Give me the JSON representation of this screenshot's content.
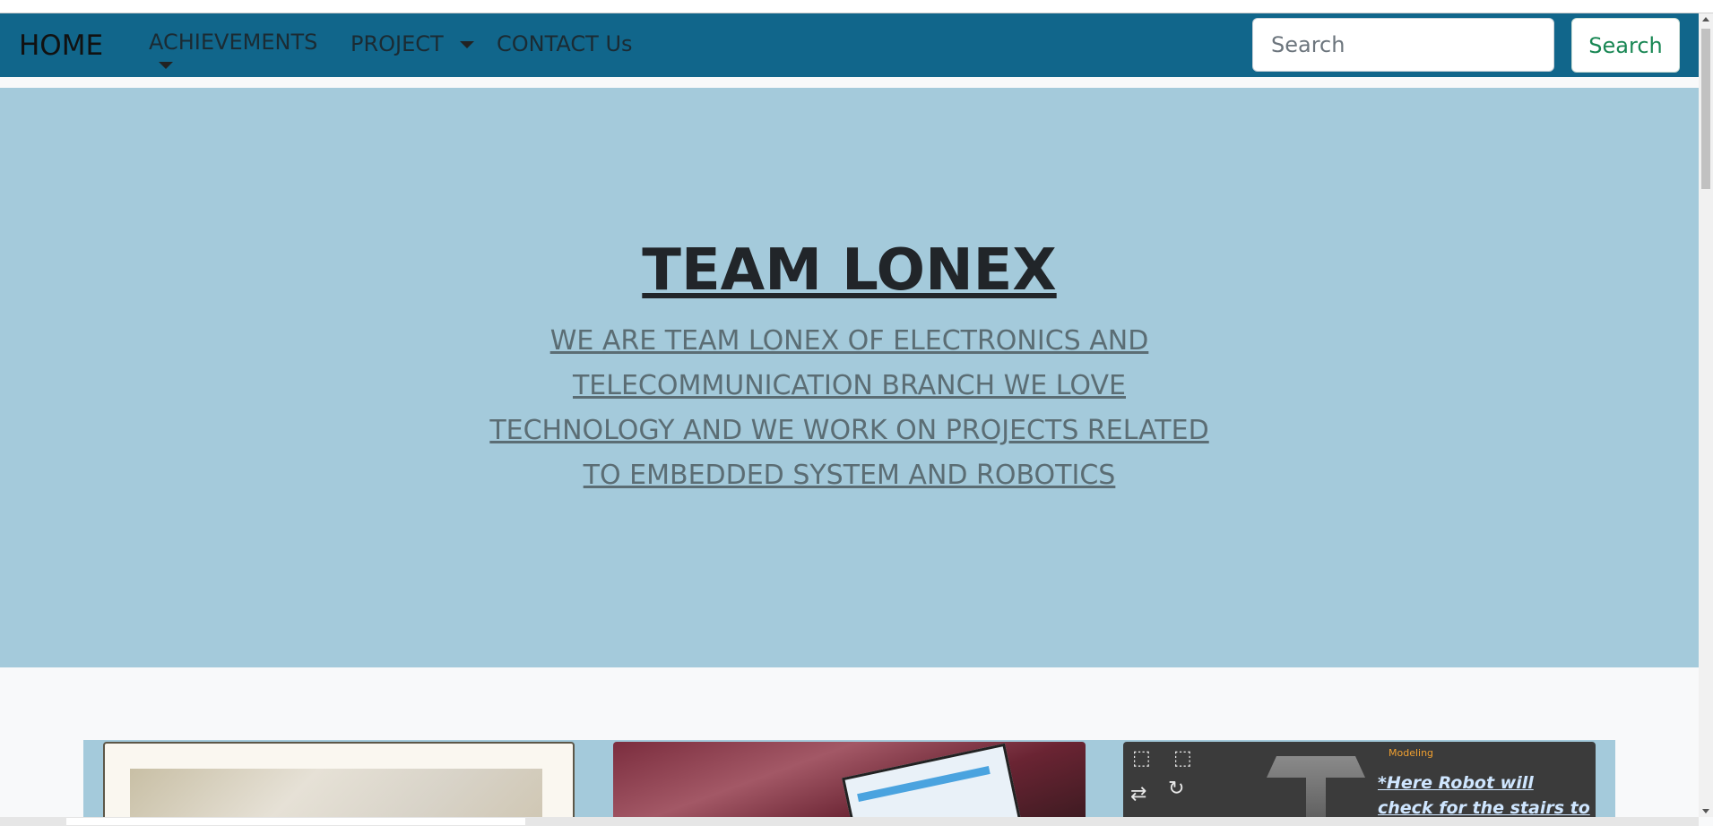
{
  "nav": {
    "brand": "HOME",
    "achievements": "ACHIEVEMENTS",
    "project": "PROJECT",
    "contact": "CONTACT Us",
    "search_placeholder": "Search",
    "search_button": "Search"
  },
  "hero": {
    "title": "TEAM LONEX",
    "subtitle": "WE ARE TEAM LONEX OF ELECTRONICS AND TELECOMMUNICATION BRANCH WE LOVE TECHNOLOGY AND WE WORK ON PROJECTS RELATED TO EMBEDDED SYSTEM AND ROBOTICS"
  },
  "gallery": {
    "card3_label": "Modeling",
    "card3_caption": "*Here Robot will check for the stairs to climb up"
  },
  "colors": {
    "navbar": "#11668b",
    "hero": "#a4cadb",
    "search_button": "#198754"
  }
}
